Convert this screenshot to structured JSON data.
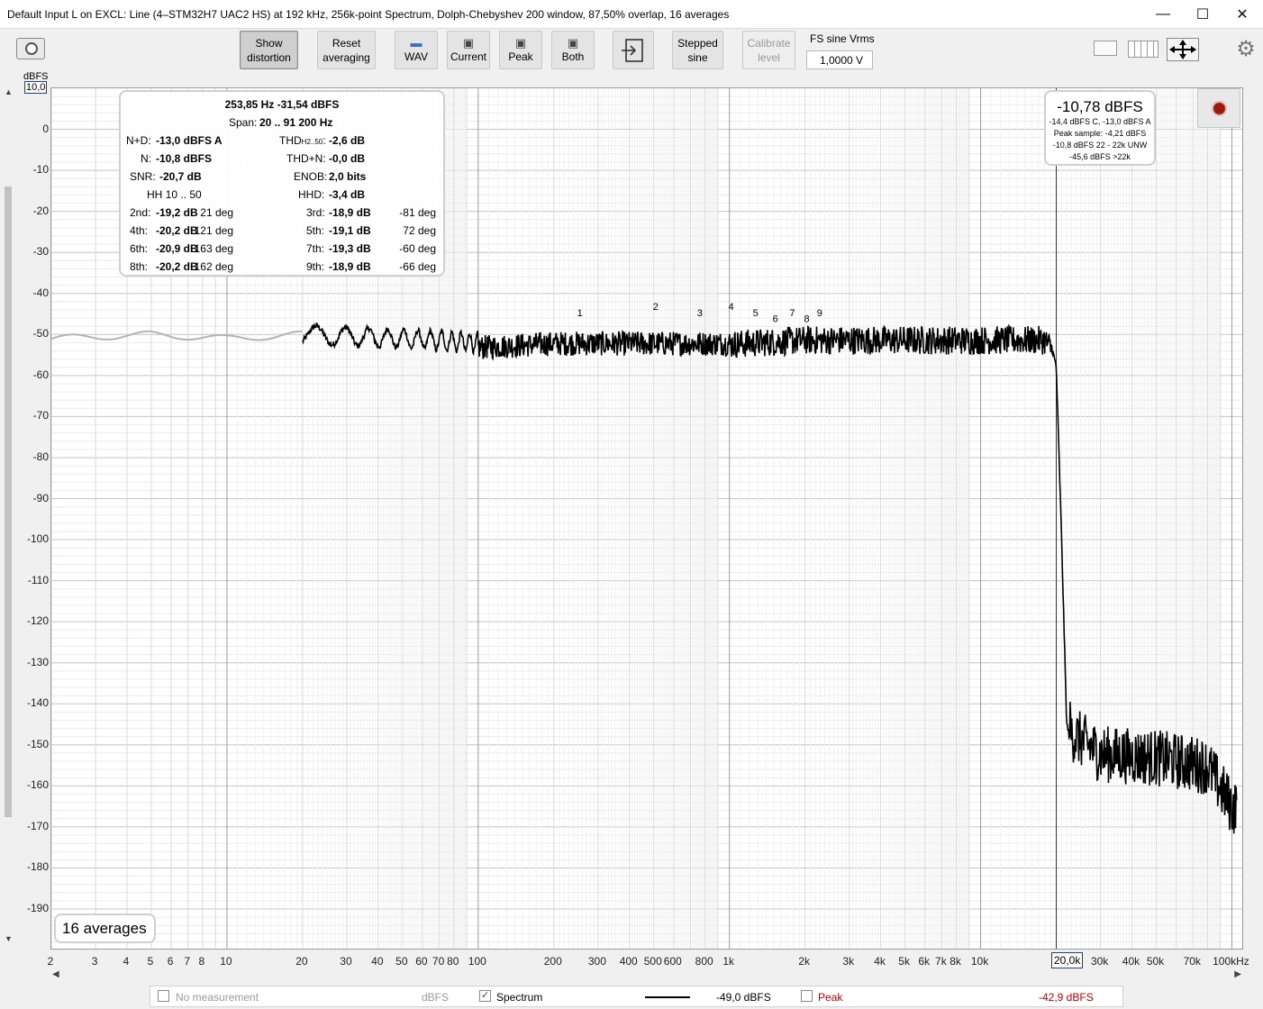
{
  "window": {
    "title": "Default Input L on EXCL: Line (4–STM32H7 UAC2 HS) at 192 kHz, 256k-point Spectrum, Dolph-Chebyshev 200 window, 87,50% overlap, 16 averages",
    "minimize": "—",
    "maximize": "☐",
    "close": "✕"
  },
  "toolbar": {
    "show_distortion": "Show\ndistortion",
    "reset_averaging": "Reset\naveraging",
    "wav": "WAV",
    "current": "Current",
    "peak": "Peak",
    "both": "Both",
    "stepped_sine": "Stepped\nsine",
    "calibrate_level": "Calibrate\nlevel",
    "fs_label": "FS sine Vrms",
    "fs_value": "1,0000 V"
  },
  "plot": {
    "y_unit": "dBFS",
    "y_top_value": "10,0",
    "x_cursor_value": "20,0k",
    "y_ticks": [
      "0",
      "-10",
      "-20",
      "-30",
      "-40",
      "-50",
      "-60",
      "-70",
      "-80",
      "-90",
      "-100",
      "-110",
      "-120",
      "-130",
      "-140",
      "-150",
      "-160",
      "-170",
      "-180",
      "-190"
    ],
    "x_ticks": [
      "2",
      "3",
      "4",
      "5",
      "6",
      "7",
      "8",
      "10",
      "20",
      "30",
      "40",
      "50",
      "60",
      "70",
      "80",
      "100",
      "200",
      "300",
      "400",
      "500",
      "600",
      "800",
      "1k",
      "2k",
      "3k",
      "4k",
      "5k",
      "6k",
      "7k",
      "8k",
      "10k",
      "30k",
      "40k",
      "50k",
      "70k",
      "100kHz"
    ],
    "harmonic_markers": [
      "1",
      "2",
      "3",
      "4",
      "5",
      "6",
      "7",
      "8",
      "9"
    ],
    "averages_badge": "16 averages"
  },
  "info_panel": {
    "header": "253,85 Hz  -31,54 dBFS",
    "span_label": "Span:",
    "span_value": "20 .. 91 200 Hz",
    "nd_label": "N+D:",
    "nd_value": "-13,0 dBFS A",
    "thd_label": "THD",
    "thd_sub": "H2..50",
    "thd_colon": ":",
    "thd_value": "-2,6 dB",
    "n_label": "N:",
    "n_value": "-10,8 dBFS",
    "thdn_label": "THD+N:",
    "thdn_value": "-0,0 dB",
    "snr_label": "SNR:",
    "snr_value": "-20,7 dB",
    "enob_label": "ENOB:",
    "enob_value": "2,0 bits",
    "hh_label": "HH 10 .. 50",
    "hhd_label": "HHD:",
    "hhd_value": "-3,4 dB",
    "harmonics": [
      {
        "l1": "2nd:",
        "v1": "-19,2 dB",
        "p1": "21 deg",
        "l2": "3rd:",
        "v2": "-18,9 dB",
        "p2": "-81 deg"
      },
      {
        "l1": "4th:",
        "v1": "-20,2 dB",
        "p1": "121 deg",
        "l2": "5th:",
        "v2": "-19,1 dB",
        "p2": "72 deg"
      },
      {
        "l1": "6th:",
        "v1": "-20,9 dB",
        "p1": "163 deg",
        "l2": "7th:",
        "v2": "-19,3 dB",
        "p2": "-60 deg"
      },
      {
        "l1": "8th:",
        "v1": "-20,2 dB",
        "p1": "162 deg",
        "l2": "9th:",
        "v2": "-18,9 dB",
        "p2": "-66 deg"
      }
    ]
  },
  "level_box": {
    "main": "-10,78 dBFS",
    "line1": "-14,4 dBFS C, -13,0 dBFS A",
    "line2": "Peak sample: -4,21 dBFS",
    "line3": "-10,8 dBFS 22 - 22k UNW",
    "line4": "-45,6 dBFS >22k"
  },
  "legend": {
    "no_measurement": "No measurement",
    "no_measurement_unit": "dBFS",
    "spectrum": "Spectrum",
    "spectrum_value": "-49,0 dBFS",
    "peak": "Peak",
    "peak_value": "-42,9 dBFS"
  },
  "colors": {
    "trace": "#000000",
    "pre_range_trace": "#b4b4b4",
    "peak_text": "#c00000",
    "cursor_box": "#1a3aa0",
    "record_dot": "#9b1a0e"
  },
  "chart_data": {
    "type": "line",
    "xlabel": "",
    "ylabel": "dBFS",
    "x_scale": "log",
    "xlim": [
      2,
      110000
    ],
    "ylim": [
      -200,
      10
    ],
    "grid": true,
    "series": [
      {
        "name": "Spectrum",
        "x": [
          2,
          5,
          10,
          20,
          50,
          100,
          200,
          500,
          1000,
          2000,
          5000,
          10000,
          18000,
          19000,
          20000,
          21000,
          22000,
          23000,
          30000,
          50000,
          80000,
          100000
        ],
        "y": [
          -51,
          -50,
          -51,
          -50,
          -51,
          -52,
          -51,
          -51,
          -51,
          -50,
          -50,
          -50,
          -50,
          -52,
          -58,
          -100,
          -145,
          -150,
          -155,
          -156,
          -158,
          -168
        ]
      }
    ]
  }
}
